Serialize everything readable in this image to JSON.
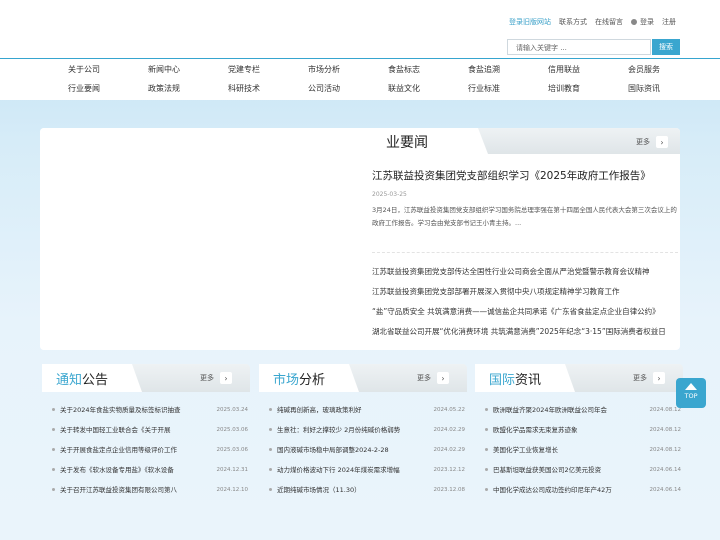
{
  "header": {
    "links": [
      "登录旧版网站",
      "联系方式",
      "在线留言"
    ],
    "login": "登录",
    "register": "注册",
    "search_placeholder": "请输入关键字 ...",
    "search_button": "搜索"
  },
  "nav": {
    "row1": [
      "关于公司",
      "新闻中心",
      "党建专栏",
      "市场分析",
      "食盐标志",
      "食盐追溯",
      "信用联益",
      "会员服务"
    ],
    "row2": [
      "行业要闻",
      "政策法规",
      "科研技术",
      "公司活动",
      "联益文化",
      "行业标准",
      "培训教育",
      "国际资讯"
    ]
  },
  "hero": {
    "tab": "业要闻",
    "more": "更多",
    "title": "江苏联益投资集团党支部组织学习《2025年政府工作报告》",
    "date": "2025-03-25",
    "summary": "3月24日，江苏联益投资集团党支部组织学习国务院总理李强在第十四届全国人民代表大会第三次会议上的政府工作报告。学习会由党支部书记王小青主持。...",
    "list": [
      "江苏联益投资集团党支部传达全国性行业公司商会全面从严治党暨警示教育会议精神",
      "江苏联益投资集团党支部部署开展深入贯彻中央八项规定精神学习教育工作",
      "“盐”守品质安全 共筑满意消费——诚信盐企共同承诺《广东省食盐定点企业自律公约》",
      "湖北省联益公司开展“优化消费环境 共筑满意消费”2025年纪念“3·15”国际消费者权益日"
    ]
  },
  "cards": [
    {
      "title_accent": "通知",
      "title_rest": "公告",
      "more": "更多",
      "items": [
        {
          "text": "关于2024年食盐实物质量及标签标识抽查",
          "date": "2025.03.24"
        },
        {
          "text": "关于转发中国轻工业联合会《关于开展",
          "date": "2025.03.06"
        },
        {
          "text": "关于开展食盐定点企业信用等级评价工作",
          "date": "2025.03.06"
        },
        {
          "text": "关于发布《软水设备专用盐》《软水设备",
          "date": "2024.12.31"
        },
        {
          "text": "关于召开江苏联益投资集团有限公司第八",
          "date": "2024.12.10"
        }
      ]
    },
    {
      "title_accent": "市场",
      "title_rest": "分析",
      "more": "更多",
      "items": [
        {
          "text": "纯碱再创新高，玻璃政策利好",
          "date": "2024.05.22"
        },
        {
          "text": "生意社：利好之撑较少 2月份纯碱价格弱势",
          "date": "2024.02.29"
        },
        {
          "text": "国内液碱市场稳中局部调整2024-2-28",
          "date": "2024.02.29"
        },
        {
          "text": "动力煤价格波动下行 2024年煤炭需求增幅",
          "date": "2023.12.12"
        },
        {
          "text": "近期纯碱市场情况（11.30）",
          "date": "2023.12.08"
        }
      ]
    },
    {
      "title_accent": "国际",
      "title_rest": "资讯",
      "more": "更多",
      "items": [
        {
          "text": "欧洲联益齐聚2024年欧洲联益公司年会",
          "date": "2024.08.12"
        },
        {
          "text": "欧盟化学品需求无束复苏迹象",
          "date": "2024.08.12"
        },
        {
          "text": "美国化学工业恢复增长",
          "date": "2024.08.12"
        },
        {
          "text": "巴基斯坦联益获美国公司2亿美元投资",
          "date": "2024.06.14"
        },
        {
          "text": "中国化学成达公司成功签约印尼年产42万",
          "date": "2024.06.14"
        }
      ]
    }
  ],
  "top_button": "TOP",
  "colors": {
    "accent": "#3aa6cf"
  }
}
